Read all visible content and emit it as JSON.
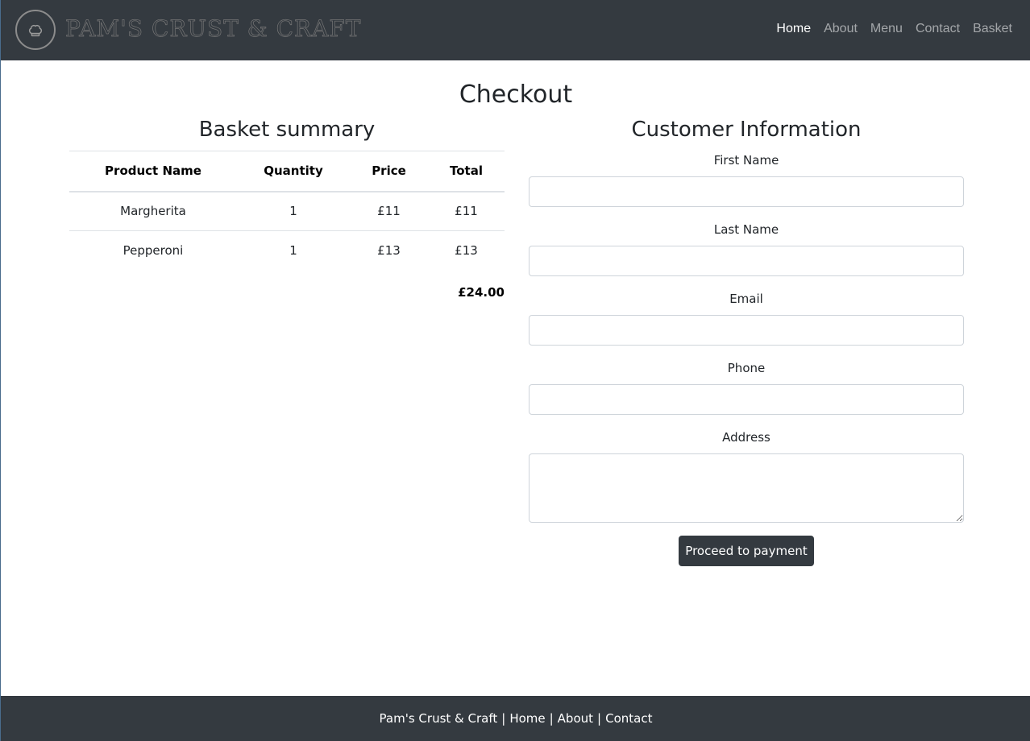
{
  "navbar": {
    "brand": "PAM'S CRUST & CRAFT",
    "logo_icon": "chef-hat-icon",
    "links": [
      "Home",
      "About",
      "Menu",
      "Contact",
      "Basket"
    ],
    "active_link": "Home"
  },
  "page": {
    "title": "Checkout"
  },
  "basket": {
    "title": "Basket summary",
    "columns": [
      "Product Name",
      "Quantity",
      "Price",
      "Total"
    ],
    "rows": [
      {
        "name": "Margherita",
        "quantity": "1",
        "price": "£11",
        "total": "£11"
      },
      {
        "name": "Pepperoni",
        "quantity": "1",
        "price": "£13",
        "total": "£13"
      }
    ],
    "grand_total": "£24.00"
  },
  "customer": {
    "title": "Customer Information",
    "first_name_label": "First Name",
    "first_name_value": "",
    "last_name_label": "Last Name",
    "last_name_value": "",
    "email_label": "Email",
    "email_value": "",
    "phone_label": "Phone",
    "phone_value": "",
    "address_label": "Address",
    "address_value": "",
    "submit_label": "Proceed to payment"
  },
  "footer": {
    "brand": "Pam's Crust & Craft",
    "separator": "|",
    "links": [
      "Home",
      "About",
      "Contact"
    ]
  },
  "colors": {
    "navbar_bg": "#343a40",
    "footer_bg": "#343a40",
    "button_bg": "#343a40",
    "nav_active": "#ffffff",
    "nav_inactive": "rgba(255,255,255,0.55)"
  }
}
